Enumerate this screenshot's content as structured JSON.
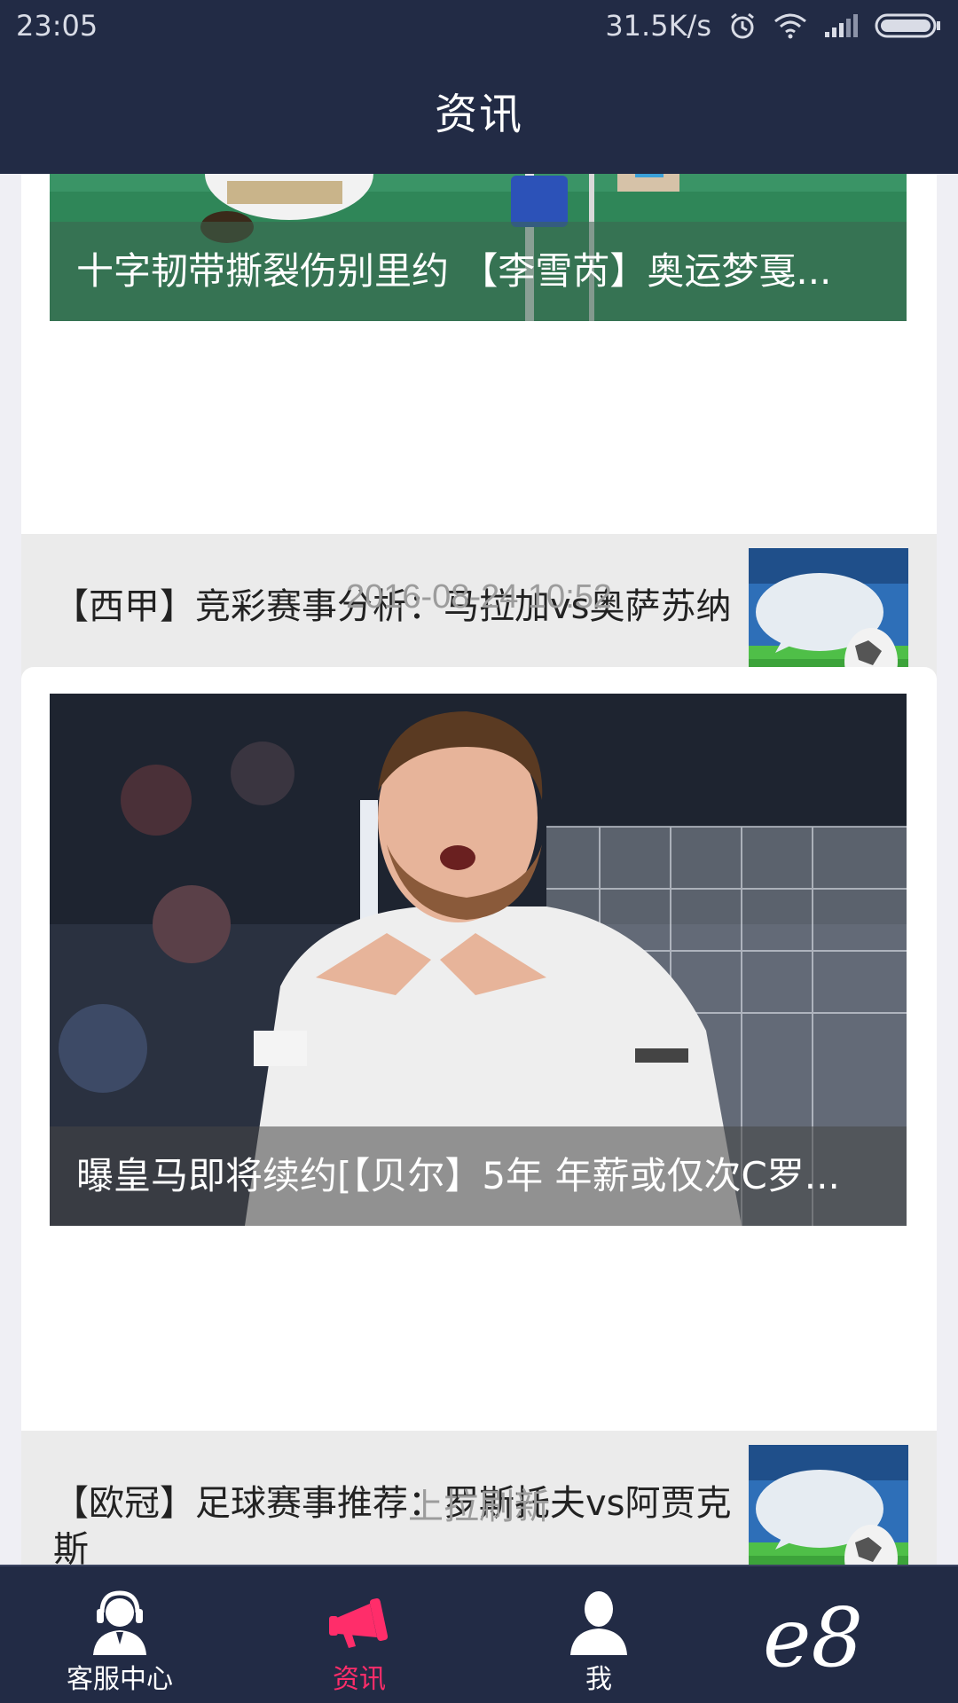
{
  "status_bar": {
    "time": "23:05",
    "speed": "31.5K/s"
  },
  "header": {
    "title": "资讯"
  },
  "feed": {
    "card1": {
      "hero_title": "十字韧带撕裂伤别里约 【李雪芮】奥运梦戛...",
      "item_title": "【西甲】竞彩赛事分析：马拉加vs奥萨苏纳"
    },
    "date": "2016-08-24 10:52",
    "card2": {
      "hero_title": "曝皇马即将续约[【贝尔】5年 年薪或仅次C罗...",
      "item_title": "【欧冠】足球赛事推荐：罗斯托夫vs阿贾克斯"
    },
    "pull_refresh": "上拉刷新"
  },
  "tabbar": {
    "tabs": [
      {
        "label": "客服中心",
        "icon": "customer-service-icon"
      },
      {
        "label": "资讯",
        "icon": "megaphone-icon",
        "active": true
      },
      {
        "label": "我",
        "icon": "user-icon"
      }
    ],
    "brand": "e8"
  },
  "colors": {
    "navy": "#222b45",
    "accent": "#ff2d6a",
    "bg": "#efeff4"
  }
}
